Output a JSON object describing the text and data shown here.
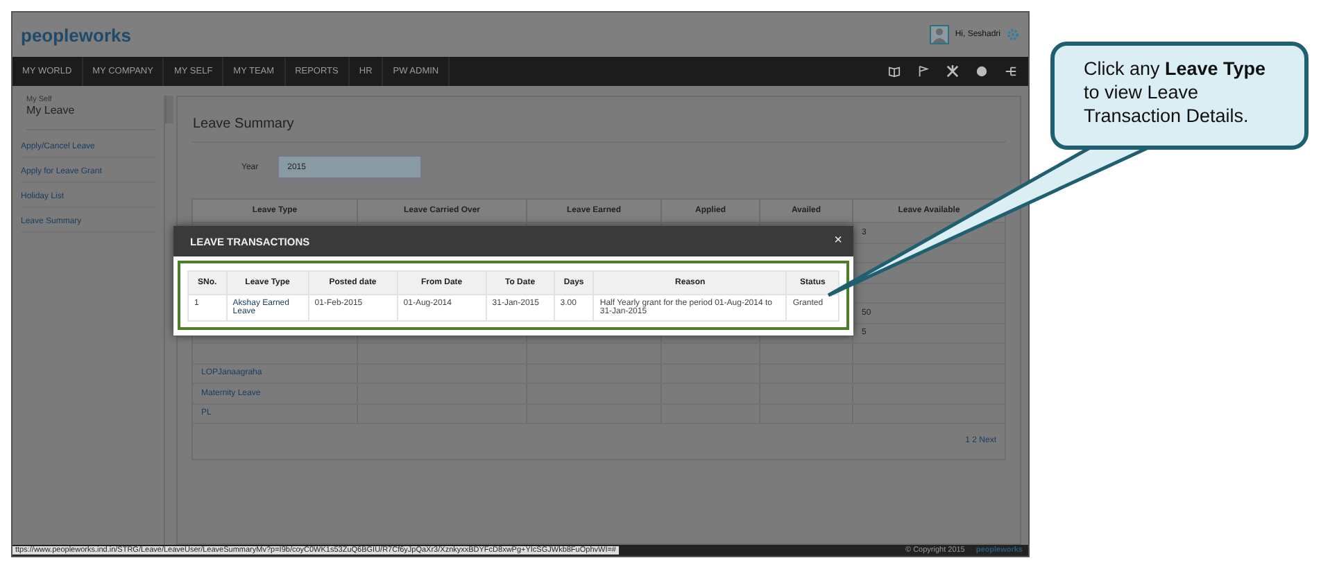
{
  "header": {
    "logo": "peopleworks",
    "greeting": "Hi, Seshadri"
  },
  "nav": {
    "items": [
      "MY WORLD",
      "MY COMPANY",
      "MY SELF",
      "MY TEAM",
      "REPORTS",
      "HR",
      "PW ADMIN"
    ]
  },
  "sidebar": {
    "section": "My Self",
    "title": "My Leave",
    "items": [
      "Apply/Cancel Leave",
      "Apply for Leave Grant",
      "Holiday List",
      "Leave Summary"
    ]
  },
  "page": {
    "title": "Leave Summary",
    "year_label": "Year",
    "year_value": "2015"
  },
  "summary_table": {
    "columns": [
      "Leave Type",
      "Leave Carried Over",
      "Leave Earned",
      "Applied",
      "Availed",
      "Leave Available"
    ],
    "rows": [
      {
        "leave_available": "3"
      },
      {},
      {},
      {},
      {
        "leave_available": "50"
      },
      {
        "leave_available": "5"
      },
      {},
      {
        "leave_type": "LOPJanaagraha"
      },
      {
        "leave_type": "Maternity Leave"
      },
      {
        "leave_type": "PL"
      }
    ],
    "pagination": "1 2 Next"
  },
  "modal": {
    "title": "LEAVE TRANSACTIONS",
    "close": "×",
    "columns": [
      "SNo.",
      "Leave Type",
      "Posted date",
      "From Date",
      "To Date",
      "Days",
      "Reason",
      "Status"
    ],
    "rows": [
      {
        "sno": "1",
        "leave_type": "Akshay Earned Leave",
        "posted_date": "01-Feb-2015",
        "from_date": "01-Aug-2014",
        "to_date": "31-Jan-2015",
        "days": "3.00",
        "reason": "Half Yearly grant for the period 01-Aug-2014 to 31-Jan-2015",
        "status": "Granted"
      }
    ]
  },
  "status_url": "ttps://www.peopleworks.ind.in/STRG/Leave/LeaveUser/LeaveSummaryMv?p=I9b/coyC0WK1s53ZuQ6BGIU/R7Cf6yJpQaXr3/XznkyxxBDYFcD8xwPg+YIcSGJWkb8FuOphvWI=#",
  "footer": {
    "copyright": "© Copyright 2015",
    "logo": "peopleworks"
  },
  "callout": {
    "text": "Click any **Leave Type** to view Leave Transaction Details."
  }
}
